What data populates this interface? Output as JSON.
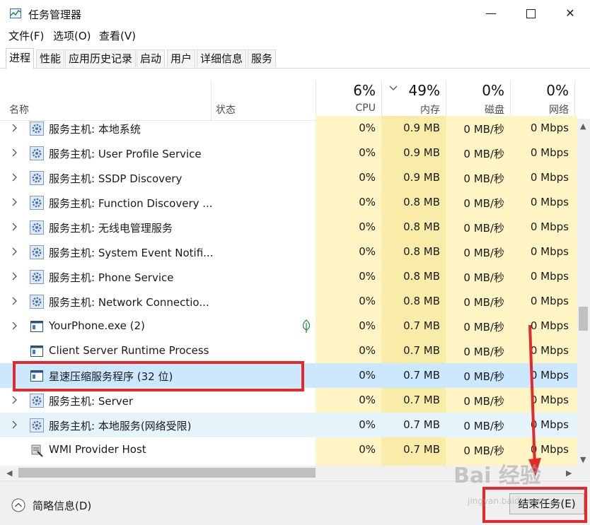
{
  "window": {
    "title": "任务管理器",
    "minimize": "—",
    "close": "✕"
  },
  "menu": [
    "文件(F)",
    "选项(O)",
    "查看(V)"
  ],
  "tabs": [
    "进程",
    "性能",
    "应用历史记录",
    "启动",
    "用户",
    "详细信息",
    "服务"
  ],
  "active_tab": "进程",
  "columns": {
    "name": "名称",
    "status": "状态",
    "cpu": {
      "pct": "6%",
      "label": "CPU"
    },
    "memory": {
      "pct": "49%",
      "label": "内存"
    },
    "disk": {
      "pct": "0%",
      "label": "磁盘"
    },
    "network": {
      "pct": "0%",
      "label": "网络"
    }
  },
  "processes": [
    {
      "name": "服务主机: 本地系统",
      "cpu": "0%",
      "memory": "0.9 MB",
      "disk": "0 MB/秒",
      "network": "0 Mbps",
      "expandable": true,
      "icon": "gear-icon",
      "state": ""
    },
    {
      "name": "服务主机: User Profile Service",
      "cpu": "0%",
      "memory": "0.9 MB",
      "disk": "0 MB/秒",
      "network": "0 Mbps",
      "expandable": true,
      "icon": "gear-icon",
      "state": ""
    },
    {
      "name": "服务主机: SSDP Discovery",
      "cpu": "0%",
      "memory": "0.9 MB",
      "disk": "0 MB/秒",
      "network": "0 Mbps",
      "expandable": true,
      "icon": "gear-icon",
      "state": ""
    },
    {
      "name": "服务主机: Function Discovery ...",
      "cpu": "0%",
      "memory": "0.8 MB",
      "disk": "0 MB/秒",
      "network": "0 Mbps",
      "expandable": true,
      "icon": "gear-icon",
      "state": ""
    },
    {
      "name": "服务主机: 无线电管理服务",
      "cpu": "0%",
      "memory": "0.8 MB",
      "disk": "0 MB/秒",
      "network": "0 Mbps",
      "expandable": true,
      "icon": "gear-icon",
      "state": ""
    },
    {
      "name": "服务主机: System Event Notifi...",
      "cpu": "0%",
      "memory": "0.8 MB",
      "disk": "0 MB/秒",
      "network": "0 Mbps",
      "expandable": true,
      "icon": "gear-icon",
      "state": ""
    },
    {
      "name": "服务主机: Phone Service",
      "cpu": "0%",
      "memory": "0.8 MB",
      "disk": "0 MB/秒",
      "network": "0 Mbps",
      "expandable": true,
      "icon": "gear-icon",
      "state": ""
    },
    {
      "name": "服务主机: Network Connectio...",
      "cpu": "0%",
      "memory": "0.8 MB",
      "disk": "0 MB/秒",
      "network": "0 Mbps",
      "expandable": true,
      "icon": "gear-icon",
      "state": ""
    },
    {
      "name": "YourPhone.exe (2)",
      "cpu": "0%",
      "memory": "0.7 MB",
      "disk": "0 MB/秒",
      "network": "0 Mbps",
      "expandable": true,
      "icon": "app-window-icon",
      "state": "",
      "suspended_leaf": true
    },
    {
      "name": "Client Server Runtime Process",
      "cpu": "0%",
      "memory": "0.7 MB",
      "disk": "0 MB/秒",
      "network": "0 Mbps",
      "expandable": false,
      "icon": "app-window-icon",
      "state": ""
    },
    {
      "name": "星速压缩服务程序 (32 位)",
      "cpu": "0%",
      "memory": "0.7 MB",
      "disk": "0 MB/秒",
      "network": "0 Mbps",
      "expandable": false,
      "icon": "app-window-icon",
      "state": "selected"
    },
    {
      "name": "服务主机: Server",
      "cpu": "0%",
      "memory": "0.7 MB",
      "disk": "0 MB/秒",
      "network": "0 Mbps",
      "expandable": true,
      "icon": "gear-icon",
      "state": ""
    },
    {
      "name": "服务主机: 本地服务(网络受限)",
      "cpu": "0%",
      "memory": "0.7 MB",
      "disk": "0 MB/秒",
      "network": "0 Mbps",
      "expandable": true,
      "icon": "gear-icon",
      "state": "hover"
    },
    {
      "name": "WMI Provider Host",
      "cpu": "0%",
      "memory": "0.7 MB",
      "disk": "0 MB/秒",
      "network": "0 Mbps",
      "expandable": false,
      "icon": "wmi-icon",
      "state": ""
    }
  ],
  "footer": {
    "brief": "简略信息(D)",
    "end_task": "结束任务(E)"
  },
  "watermark": {
    "text": "Bai 经验",
    "url": "jingyan.baidu.com"
  },
  "colors": {
    "cpu_col": "#fff4c4",
    "mem_col": "#f9eca8",
    "selected": "#cce8ff",
    "hover": "#e5f3fb",
    "annotation": "#e22a2a"
  }
}
